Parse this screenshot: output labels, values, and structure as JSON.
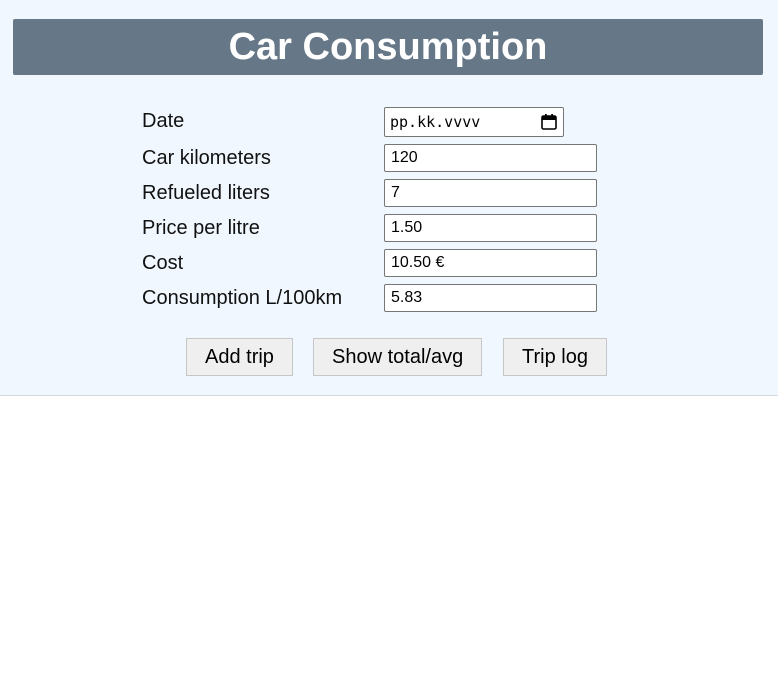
{
  "header": {
    "title": "Car Consumption"
  },
  "form": {
    "date": {
      "label": "Date",
      "placeholder": "pp.kk.vvvv"
    },
    "kilometers": {
      "label": "Car kilometers",
      "value": "120"
    },
    "liters": {
      "label": "Refueled liters",
      "value": "7"
    },
    "price": {
      "label": "Price per litre",
      "value": "1.50"
    },
    "cost": {
      "label": "Cost",
      "value": "10.50 €"
    },
    "consumption": {
      "label": "Consumption L/100km",
      "value": "5.83"
    }
  },
  "buttons": {
    "add_trip": "Add trip",
    "show_total": "Show total/avg",
    "trip_log": "Trip log"
  },
  "colors": {
    "header_bg": "#667788",
    "panel_bg": "#f0f7ff"
  }
}
